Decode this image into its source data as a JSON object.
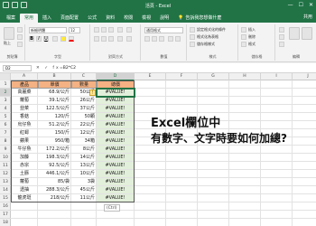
{
  "window": {
    "title": "活頁 - Excel",
    "controls": [
      "—",
      "☐",
      "✕"
    ]
  },
  "ribbon": {
    "tabs": [
      "檔案",
      "常用",
      "插入",
      "頁面配置",
      "公式",
      "資料",
      "校閱",
      "檢視",
      "說明"
    ],
    "active_tab": 1,
    "tell_me": "告訴我您想做什麼",
    "share": "共用",
    "font_name": "新細明體",
    "font_size": "12",
    "number_format": "通用格式",
    "groups": {
      "clipboard": "剪貼簿",
      "font": "字型",
      "alignment": "對齊方式",
      "number": "數值",
      "styles": "樣式",
      "cells": "儲存格",
      "editing": "編輯"
    },
    "styles_items": [
      "設定格式化的條件",
      "格式化為表格",
      "儲存格樣式"
    ],
    "cells_items": [
      "插入",
      "刪除",
      "格式"
    ],
    "paste_label": "貼上"
  },
  "formula_bar": {
    "name_box": "D2",
    "fx": "✕ ✓ fx",
    "formula": "=B2*C2"
  },
  "sheet": {
    "columns": [
      "A",
      "B",
      "C",
      "D",
      "E",
      "F",
      "G",
      "H",
      "I",
      "J"
    ],
    "selected_column": "D",
    "row_numbers": [
      "1",
      "2",
      "3",
      "4",
      "5",
      "6",
      "7",
      "8",
      "9",
      "10",
      "11",
      "12",
      "13",
      "14",
      "15",
      "16",
      "17",
      "18"
    ],
    "selected_row": "2",
    "headers": [
      "產品",
      "單價",
      "數量",
      "總價"
    ],
    "rows": [
      [
        "高麗菜",
        "68.9/公斤",
        "50公斤",
        "#VALUE!"
      ],
      [
        "蘿蔔",
        "39.1/公斤",
        "26公斤",
        "#VALUE!"
      ],
      [
        "韭菜",
        "122.5/公斤",
        "37公斤",
        "#VALUE!"
      ],
      [
        "香菇",
        "120/斤",
        "50顆",
        "#VALUE!"
      ],
      [
        "烏仔魚",
        "51.2/公斤",
        "22公斤",
        "#VALUE!"
      ],
      [
        "紅蟳",
        "150/斤",
        "12公斤",
        "#VALUE!"
      ],
      [
        "蘋果",
        "950/箱",
        "34箱",
        "#VALUE!"
      ],
      [
        "牛仔魚",
        "172.2/公斤",
        "8公斤",
        "#VALUE!"
      ],
      [
        "加藤",
        "198.3/公斤",
        "14公斤",
        "#VALUE!"
      ],
      [
        "赤宗",
        "92.5/公斤",
        "13公斤",
        "#VALUE!"
      ],
      [
        "土豚",
        "446.1/公斤",
        "10公斤",
        "#VALUE!"
      ],
      [
        "蘿蔔",
        "85/袋",
        "3袋",
        "#VALUE!"
      ],
      [
        "透抽",
        "288.3/公斤",
        "45公斤",
        "#VALUE!"
      ],
      [
        "龍虎斑",
        "218/公斤",
        "11公斤",
        "#VALUE!"
      ]
    ],
    "error_flag": "!",
    "paste_options": "(Ctrl)"
  },
  "overlay_text": {
    "line1": "Excel欄位中",
    "line2": "有數字、文字時要如何加總?"
  },
  "colors": {
    "excel_green": "#217346",
    "header_fill": "#f4b183",
    "result_fill": "#e2efda"
  }
}
